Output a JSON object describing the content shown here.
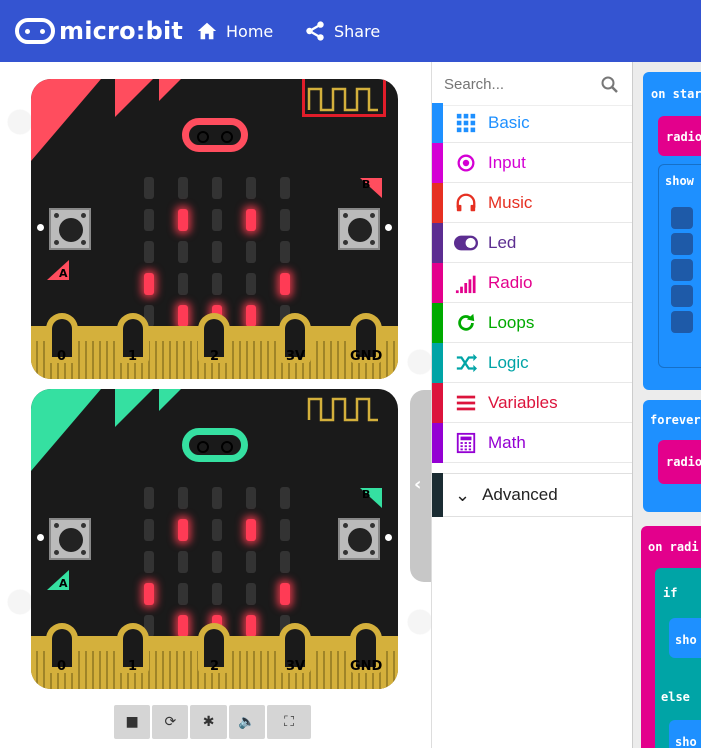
{
  "header": {
    "logo_text": "micro:bit",
    "home_label": "Home",
    "share_label": "Share",
    "home_icon": "home-icon",
    "share_icon": "share-icon"
  },
  "simulator": {
    "boards": [
      {
        "theme": "red",
        "corner_color": "#ff4d5e",
        "logo_color": "#ff4d5e",
        "button_a_label": "A",
        "button_b_label": "B",
        "pins": [
          "0",
          "1",
          "2",
          "3V",
          "GND"
        ]
      },
      {
        "theme": "green",
        "corner_color": "#35e0a1",
        "logo_color": "#35e0a1",
        "button_a_label": "A",
        "button_b_label": "B",
        "pins": [
          "0",
          "1",
          "2",
          "3V",
          "GND"
        ]
      }
    ],
    "led_pattern": [
      [
        0,
        0,
        0,
        0,
        0
      ],
      [
        0,
        1,
        0,
        1,
        0
      ],
      [
        0,
        0,
        0,
        0,
        0
      ],
      [
        1,
        0,
        0,
        0,
        1
      ],
      [
        0,
        1,
        1,
        1,
        0
      ]
    ],
    "toolbar": [
      "stop-icon",
      "restart-icon",
      "debug-icon",
      "sound-icon",
      "fullscreen-icon"
    ]
  },
  "toolbox": {
    "search_placeholder": "Search...",
    "categories": [
      {
        "label": "Basic",
        "color": "#1e90ff",
        "icon": "grid-icon"
      },
      {
        "label": "Input",
        "color": "#d400d4",
        "icon": "radio-target-icon"
      },
      {
        "label": "Music",
        "color": "#e63022",
        "icon": "headphones-icon"
      },
      {
        "label": "Led",
        "color": "#5c2d91",
        "icon": "toggle-icon"
      },
      {
        "label": "Radio",
        "color": "#e3008c",
        "icon": "signal-bars-icon"
      },
      {
        "label": "Loops",
        "color": "#00aa00",
        "icon": "loop-icon"
      },
      {
        "label": "Logic",
        "color": "#00a4a6",
        "icon": "shuffle-icon"
      },
      {
        "label": "Variables",
        "color": "#dc143c",
        "icon": "list-icon"
      },
      {
        "label": "Math",
        "color": "#9400d3",
        "icon": "calculator-icon"
      }
    ],
    "advanced_label": "Advanced"
  },
  "workspace": {
    "blocks": [
      "on star",
      "radio",
      "show",
      "forever",
      "radio",
      "on radi",
      "if",
      "sho",
      "else",
      "sho"
    ]
  },
  "colors": {
    "header": "#3454d1",
    "board_bg": "#1a1a1a",
    "gold": "#d4b03c",
    "highlight": "#e11d2a"
  }
}
